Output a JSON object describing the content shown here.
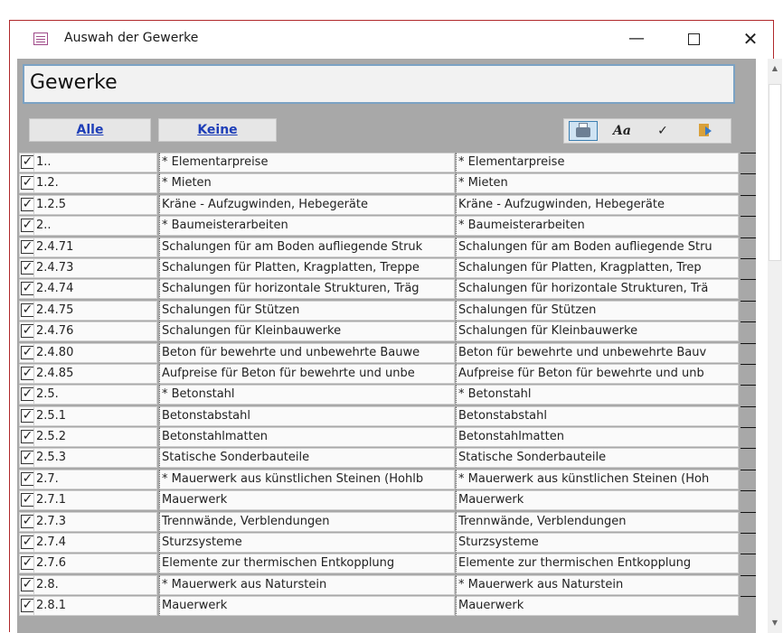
{
  "window": {
    "title": "Auswah der Gewerke",
    "minimize": "—",
    "close": "✕"
  },
  "form": {
    "heading": "Gewerke",
    "btn_alle": "Alle",
    "btn_keine": "Keine",
    "toolbar": {
      "font_label": "Aa",
      "check_label": "✓"
    }
  },
  "rows": [
    {
      "checked": true,
      "code": "1..",
      "b1": "* Elementarpreise",
      "b2": "* Elementarpreise"
    },
    {
      "checked": true,
      "code": "1.2.",
      "b1": "* Mieten",
      "b2": "* Mieten"
    },
    {
      "checked": true,
      "code": "1.2.5",
      "b1": "Kräne - Aufzugwinden, Hebegeräte",
      "b2": "Kräne - Aufzugwinden, Hebegeräte"
    },
    {
      "checked": true,
      "code": "2..",
      "b1": "* Baumeisterarbeiten",
      "b2": "* Baumeisterarbeiten"
    },
    {
      "checked": true,
      "code": "2.4.71",
      "b1": "Schalungen für am Boden aufliegende Struk",
      "b2": "Schalungen für am Boden aufliegende Stru"
    },
    {
      "checked": true,
      "code": "2.4.73",
      "b1": "Schalungen für Platten, Kragplatten, Treppe",
      "b2": "Schalungen für Platten, Kragplatten, Trep"
    },
    {
      "checked": true,
      "code": "2.4.74",
      "b1": "Schalungen für horizontale Strukturen, Träg",
      "b2": "Schalungen für horizontale Strukturen, Trä"
    },
    {
      "checked": true,
      "code": "2.4.75",
      "b1": "Schalungen für Stützen",
      "b2": "Schalungen für Stützen"
    },
    {
      "checked": true,
      "code": "2.4.76",
      "b1": "Schalungen für Kleinbauwerke",
      "b2": "Schalungen für Kleinbauwerke"
    },
    {
      "checked": true,
      "code": "2.4.80",
      "b1": "Beton für bewehrte und unbewehrte Bauwe",
      "b2": "Beton für bewehrte und unbewehrte Bauv"
    },
    {
      "checked": true,
      "code": "2.4.85",
      "b1": "Aufpreise für Beton für bewehrte und unbe",
      "b2": "Aufpreise für Beton für bewehrte und unb"
    },
    {
      "checked": true,
      "code": "2.5.",
      "b1": "* Betonstahl",
      "b2": "* Betonstahl"
    },
    {
      "checked": true,
      "code": "2.5.1",
      "b1": "Betonstabstahl",
      "b2": "Betonstabstahl"
    },
    {
      "checked": true,
      "code": "2.5.2",
      "b1": "Betonstahlmatten",
      "b2": "Betonstahlmatten"
    },
    {
      "checked": true,
      "code": "2.5.3",
      "b1": "Statische Sonderbauteile",
      "b2": "Statische Sonderbauteile"
    },
    {
      "checked": true,
      "code": "2.7.",
      "b1": "* Mauerwerk aus künstlichen Steinen (Hohlb",
      "b2": "* Mauerwerk aus künstlichen Steinen (Hoh"
    },
    {
      "checked": true,
      "code": "2.7.1",
      "b1": "Mauerwerk",
      "b2": "Mauerwerk"
    },
    {
      "checked": true,
      "code": "2.7.3",
      "b1": "Trennwände, Verblendungen",
      "b2": "Trennwände, Verblendungen"
    },
    {
      "checked": true,
      "code": "2.7.4",
      "b1": "Sturzsysteme",
      "b2": "Sturzsysteme"
    },
    {
      "checked": true,
      "code": "2.7.6",
      "b1": "Elemente zur thermischen Entkopplung",
      "b2": "Elemente zur thermischen Entkopplung"
    },
    {
      "checked": true,
      "code": "2.8.",
      "b1": "* Mauerwerk aus Naturstein",
      "b2": "* Mauerwerk aus Naturstein"
    },
    {
      "checked": true,
      "code": "2.8.1",
      "b1": "Mauerwerk",
      "b2": "Mauerwerk"
    }
  ]
}
